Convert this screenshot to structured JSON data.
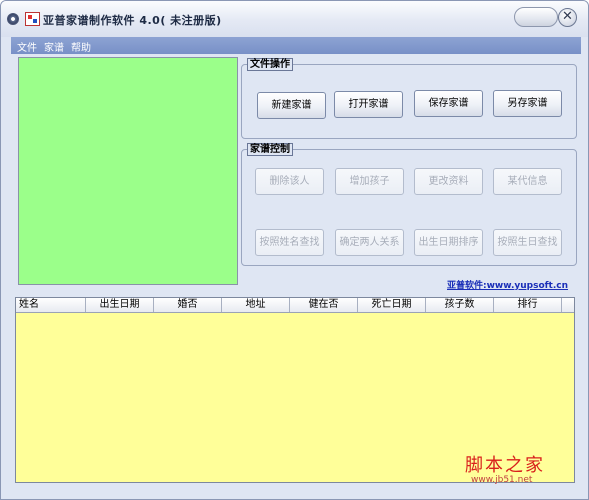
{
  "window": {
    "title": "亚普家谱制作软件 4.0( 未注册版)",
    "close_glyph": "✕"
  },
  "menu": [
    "文件",
    "家谱",
    "帮助"
  ],
  "file_group": {
    "label": "文件操作",
    "buttons": [
      "新建家谱",
      "打开家谱",
      "保存家谱",
      "另存家谱"
    ]
  },
  "control_group": {
    "label": "家谱控制",
    "buttons_row1": [
      "删除该人",
      "增加孩子",
      "更改资料",
      "某代信息"
    ],
    "buttons_row2": [
      "按照姓名查找",
      "确定两人关系",
      "出生日期排序",
      "按照生日查找"
    ]
  },
  "link_text": "亚普软件:www.yupsoft.cn",
  "table": {
    "columns": [
      "姓名",
      "出生日期",
      "婚否",
      "地址",
      "健在否",
      "死亡日期",
      "孩子数",
      "排行"
    ]
  },
  "watermark": {
    "text": "脚本之家",
    "url": "www.jb51.net"
  },
  "colors": {
    "tree_panel": "#9bff8a",
    "table_bg": "#ffff99",
    "menubar": "#8098cb",
    "link": "#1a2fb8",
    "watermark": "#d9201c"
  },
  "icons": [
    "system-menu-icon",
    "app-logo-icon",
    "close-icon"
  ]
}
